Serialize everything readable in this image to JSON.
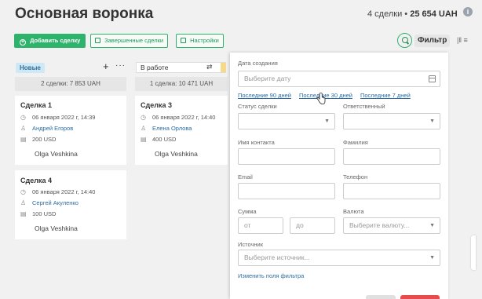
{
  "page": {
    "title": "Основная воронка"
  },
  "header": {
    "deals_count": "4 сделки",
    "separator": "•",
    "total_sum": "25 654 UAH",
    "info_icon": "info-icon"
  },
  "toolbar": {
    "add_deal": "Добавить сделку",
    "completed_deals": "Завершенные сделки",
    "settings": "Настройки",
    "filter": "Фильтр"
  },
  "columns": [
    {
      "name": "Новые",
      "summary": "2 сделки: 7 853 UAH",
      "accent": "#cfe8f5"
    },
    {
      "name": "В работе",
      "summary": "1 сделка: 10 471 UAH",
      "accent": "#f6d98a"
    }
  ],
  "cards": [
    {
      "title": "Сделка 1",
      "date": "06 января 2022 г, 14:39",
      "contact": "Андрей Егоров",
      "amount": "200 USD",
      "owner": "Olga Veshkina"
    },
    {
      "title": "Сделка 3",
      "date": "06 января 2022 г, 14:40",
      "contact": "Елена Орлова",
      "amount": "400 USD",
      "owner": "Olga Veshkina"
    },
    {
      "title": "Сделка 4",
      "date": "06 января 2022 г, 14:40",
      "contact": "Сергей Акуленко",
      "amount": "100 USD",
      "owner": "Olga Veshkina"
    }
  ],
  "filter_panel": {
    "created_date": {
      "label": "Дата создания",
      "placeholder": "Выберите дату"
    },
    "quick_ranges": [
      "Последние 90 дней",
      "Последние 30 дней",
      "Последние 7 дней"
    ],
    "deal_status": {
      "label": "Статус сделки",
      "value": ""
    },
    "responsible": {
      "label": "Ответственный",
      "value": ""
    },
    "contact_name": {
      "label": "Имя контакта",
      "value": ""
    },
    "surname": {
      "label": "Фамилия",
      "value": ""
    },
    "email": {
      "label": "Email",
      "value": ""
    },
    "phone": {
      "label": "Телефон",
      "value": ""
    },
    "amount": {
      "label": "Сумма",
      "from_placeholder": "от",
      "to_placeholder": "до"
    },
    "currency": {
      "label": "Валюта",
      "placeholder": "Выберите валюту..."
    },
    "source": {
      "label": "Источник",
      "placeholder": "Выберите источник..."
    },
    "change_fields_link": "Изменить поля фильтра"
  },
  "colors": {
    "primary_green": "#2db36b",
    "link_blue": "#2b6ca3",
    "danger_red": "#e84b4b"
  }
}
